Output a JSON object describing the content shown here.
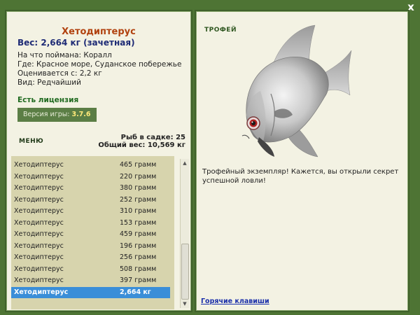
{
  "close_label": "x",
  "fish": {
    "name": "Хетодиптерус",
    "weight_line": "Вес: 2,664 кг (зачетная)",
    "bait": "На что поймана: Коралл",
    "location": "Где: Красное море, Суданское побережье",
    "valued_from": "Оценивается с: 2,2 кг",
    "type": "Вид: Редчайший"
  },
  "license": "Есть лицензия",
  "version": {
    "label": "Версия игры:",
    "value": "3.7.6"
  },
  "menu_label": "МЕНЮ",
  "cage": {
    "count": "Рыб в садке: 25",
    "total": "Общий вес: 10,569 кг"
  },
  "catch_list": [
    {
      "name": "Хетодиптерус",
      "weight": "465 грамм"
    },
    {
      "name": "Хетодиптерус",
      "weight": "220 грамм"
    },
    {
      "name": "Хетодиптерус",
      "weight": "380 грамм"
    },
    {
      "name": "Хетодиптерус",
      "weight": "252 грамм"
    },
    {
      "name": "Хетодиптерус",
      "weight": "310 грамм"
    },
    {
      "name": "Хетодиптерус",
      "weight": "153 грамм"
    },
    {
      "name": "Хетодиптерус",
      "weight": "459 грамм"
    },
    {
      "name": "Хетодиптерус",
      "weight": "196 грамм"
    },
    {
      "name": "Хетодиптерус",
      "weight": "256 грамм"
    },
    {
      "name": "Хетодиптерус",
      "weight": "508 грамм"
    },
    {
      "name": "Хетодиптерус",
      "weight": "397 грамм"
    },
    {
      "name": "Хетодиптерус",
      "weight": "2,664 кг",
      "selected": true
    }
  ],
  "trophy": {
    "title": "ТРОФЕЙ",
    "text": "Трофейный экземпляр! Кажется, вы открыли секрет успешной ловли!"
  },
  "hotkeys_label": "Горячие клавиши",
  "colors": {
    "background": "#4e7434",
    "panel": "#f3f2e3",
    "list": "#d7d4ad",
    "selected_row": "#3a8ed8",
    "fish_name": "#b1420f"
  }
}
